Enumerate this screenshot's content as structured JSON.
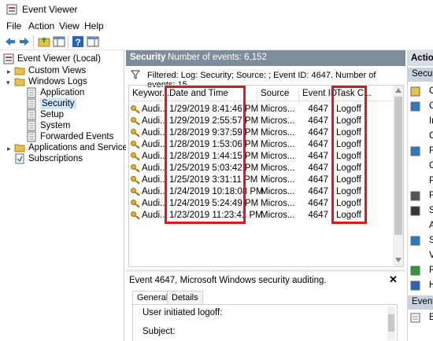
{
  "window": {
    "title": "Event Viewer"
  },
  "menu": [
    "File",
    "Action",
    "View",
    "Help"
  ],
  "tree": {
    "root": "Event Viewer (Local)",
    "items": [
      {
        "label": "Custom Views"
      },
      {
        "label": "Windows Logs"
      },
      {
        "label": "Application"
      },
      {
        "label": "Security"
      },
      {
        "label": "Setup"
      },
      {
        "label": "System"
      },
      {
        "label": "Forwarded Events"
      },
      {
        "label": "Applications and Services Lo"
      },
      {
        "label": "Subscriptions"
      }
    ]
  },
  "log": {
    "name": "Security",
    "count_text": "Number of events: 6,152",
    "filter_text": "Filtered: Log: Security; Source: ; Event ID: 4647. Number of events: 15"
  },
  "grid": {
    "columns": [
      "Keywor...",
      "Date and Time",
      "Source",
      "Event ID",
      "Task C..."
    ],
    "rows": [
      {
        "keyword": "Audi...",
        "date": "1/29/2019 8:41:46 PM",
        "source": "Micros...",
        "event_id": "4647",
        "task": "Logoff"
      },
      {
        "keyword": "Audi...",
        "date": "1/29/2019 2:55:57 PM",
        "source": "Micros...",
        "event_id": "4647",
        "task": "Logoff"
      },
      {
        "keyword": "Audi...",
        "date": "1/28/2019 9:37:59 PM",
        "source": "Micros...",
        "event_id": "4647",
        "task": "Logoff"
      },
      {
        "keyword": "Audi...",
        "date": "1/28/2019 1:53:06 PM",
        "source": "Micros...",
        "event_id": "4647",
        "task": "Logoff"
      },
      {
        "keyword": "Audi...",
        "date": "1/28/2019 1:44:15 PM",
        "source": "Micros...",
        "event_id": "4647",
        "task": "Logoff"
      },
      {
        "keyword": "Audi...",
        "date": "1/25/2019 5:03:42 PM",
        "source": "Micros...",
        "event_id": "4647",
        "task": "Logoff"
      },
      {
        "keyword": "Audi...",
        "date": "1/25/2019 3:31:11 PM",
        "source": "Micros...",
        "event_id": "4647",
        "task": "Logoff"
      },
      {
        "keyword": "Audi...",
        "date": "1/24/2019 10:18:08 PM",
        "source": "Micros...",
        "event_id": "4647",
        "task": "Logoff"
      },
      {
        "keyword": "Audi...",
        "date": "1/24/2019 5:24:49 PM",
        "source": "Micros...",
        "event_id": "4647",
        "task": "Logoff"
      },
      {
        "keyword": "Audi...",
        "date": "1/23/2019 11:23:41 PM",
        "source": "Micros...",
        "event_id": "4647",
        "task": "Logoff"
      }
    ]
  },
  "detail": {
    "title": "Event 4647, Microsoft Windows security auditing.",
    "tabs": [
      "General",
      "Details"
    ],
    "lines": [
      "User initiated logoff:",
      "Subject:"
    ]
  },
  "actions": {
    "header": "Action",
    "sub1": "Securi",
    "items": [
      "O",
      "C",
      "In",
      "C",
      "Fi",
      "C",
      "Pr",
      "Fi",
      "Sa",
      "A",
      "Sa",
      "Vi",
      "Re",
      "H"
    ],
    "sub2": "Event",
    "bottom": "Ev"
  },
  "colors": {
    "highlight": "#e8131b",
    "header_bar": "#7f8c99",
    "selection": "#cce8ff"
  }
}
